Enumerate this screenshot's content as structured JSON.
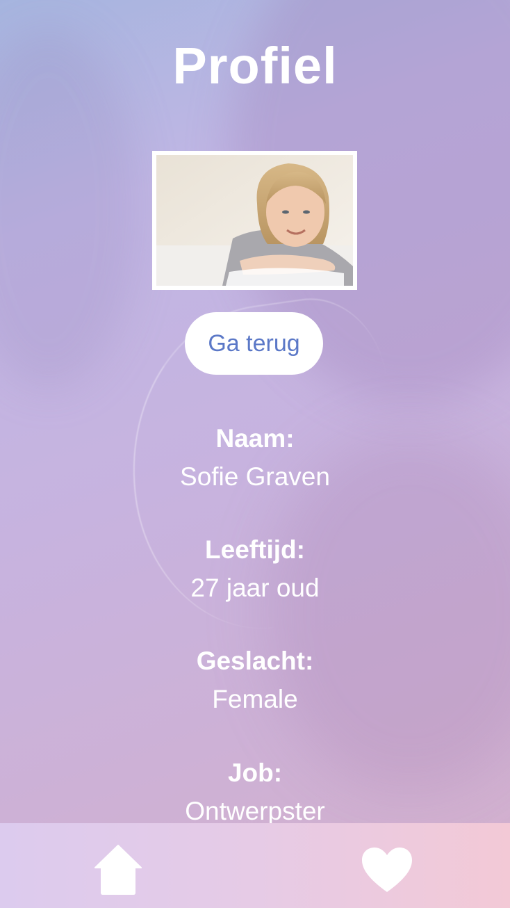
{
  "header": {
    "title": "Profiel"
  },
  "profile": {
    "photo_alt": "profile-photo",
    "back_button_label": "Ga terug",
    "fields": {
      "name": {
        "label": "Naam:",
        "value": "Sofie Graven"
      },
      "age": {
        "label": "Leeftijd:",
        "value": "27 jaar oud"
      },
      "gender": {
        "label": "Geslacht:",
        "value": "Female"
      },
      "job": {
        "label": "Job:",
        "value": "Ontwerpster"
      }
    }
  },
  "nav": {
    "items": [
      {
        "icon": "home-icon"
      },
      {
        "icon": "heart-icon"
      }
    ]
  },
  "colors": {
    "accent": "#5b78c7",
    "text": "#ffffff"
  }
}
